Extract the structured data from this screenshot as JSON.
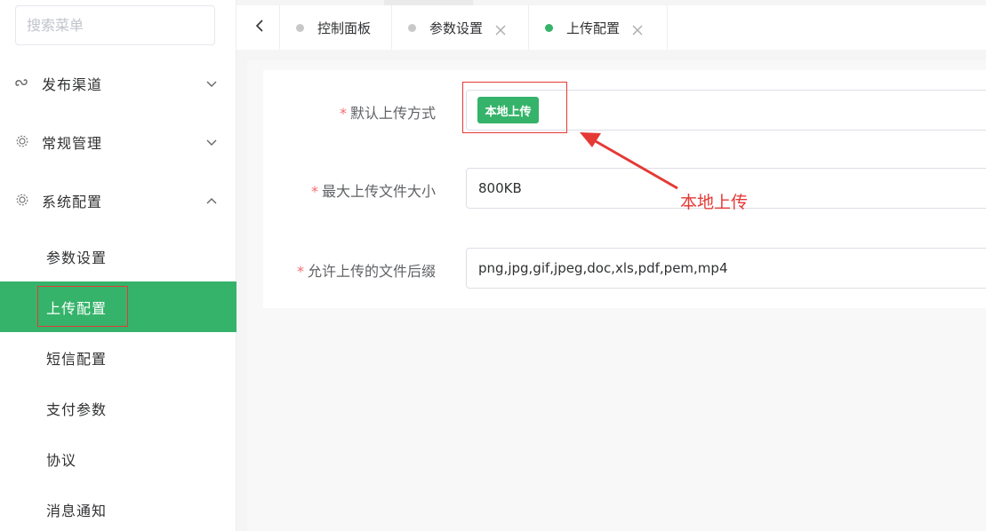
{
  "sidebar": {
    "search_placeholder": "搜索菜单",
    "groups": [
      {
        "label": "发布渠道",
        "icon": "link-icon",
        "expanded": false
      },
      {
        "label": "常规管理",
        "icon": "gear-icon",
        "expanded": false
      },
      {
        "label": "系统配置",
        "icon": "gear-icon",
        "expanded": true
      }
    ],
    "sub_items": [
      {
        "label": "参数设置",
        "active": false
      },
      {
        "label": "上传配置",
        "active": true
      },
      {
        "label": "短信配置",
        "active": false
      },
      {
        "label": "支付参数",
        "active": false
      },
      {
        "label": "协议",
        "active": false
      },
      {
        "label": "消息通知",
        "active": false
      }
    ]
  },
  "tabs": [
    {
      "label": "控制面板",
      "closable": false,
      "active": false
    },
    {
      "label": "参数设置",
      "closable": true,
      "active": false
    },
    {
      "label": "上传配置",
      "closable": true,
      "active": true
    }
  ],
  "form": {
    "required_mark": "*",
    "default_upload": {
      "label": "默认上传方式",
      "button": "本地上传"
    },
    "max_size": {
      "label": "最大上传文件大小",
      "value": "800KB"
    },
    "allowed_ext": {
      "label": "允许上传的文件后缀",
      "value": "png,jpg,gif,jpeg,doc,xls,pdf,pem,mp4"
    }
  },
  "annotation": {
    "text": "本地上传"
  },
  "colors": {
    "accent": "#35b36a",
    "annotation": "#e53935",
    "required": "#f56c6c"
  }
}
